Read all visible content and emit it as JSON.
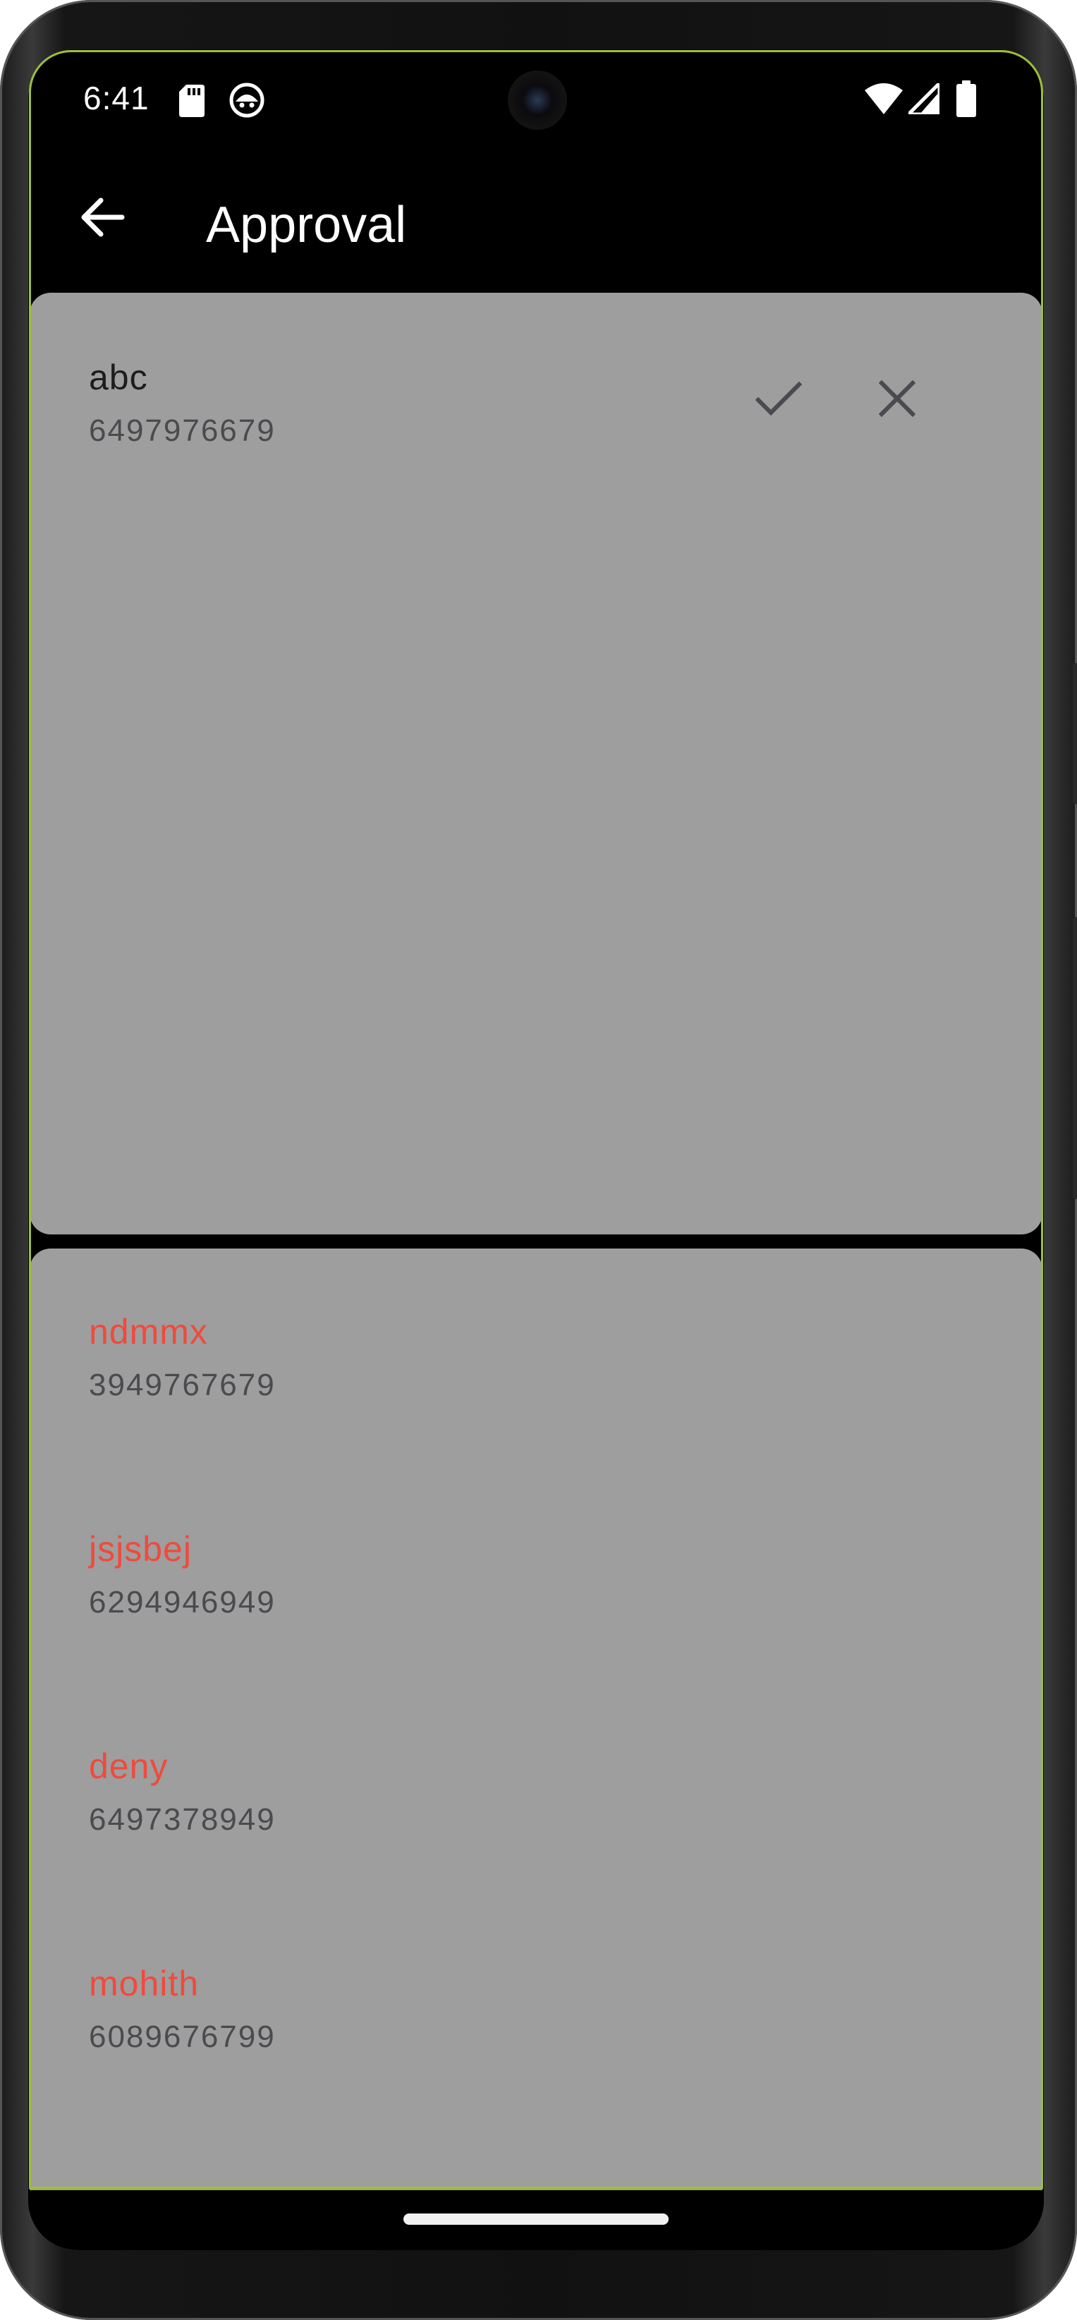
{
  "status_bar": {
    "time": "6:41",
    "left_icons": [
      "sd-card-icon",
      "android-debug-icon"
    ],
    "right_icons": [
      "wifi-icon",
      "signal-icon",
      "battery-icon"
    ]
  },
  "app_bar": {
    "title": "Approval",
    "back_icon": "arrow-back-icon"
  },
  "pending": {
    "items": [
      {
        "name": "abc",
        "phone": "6497976679",
        "approve_icon": "check-icon",
        "reject_icon": "close-icon"
      }
    ]
  },
  "rejected": {
    "items": [
      {
        "name": "ndmmx",
        "phone": "3949767679"
      },
      {
        "name": "jsjsbej",
        "phone": "6294946949"
      },
      {
        "name": "deny",
        "phone": "6497378949"
      },
      {
        "name": "mohith",
        "phone": "6089676799"
      }
    ]
  },
  "colors": {
    "card_background": "#9e9e9e",
    "rejected_name": "#f04a3c",
    "screen_border": "#9bc03a",
    "background": "#000000"
  }
}
